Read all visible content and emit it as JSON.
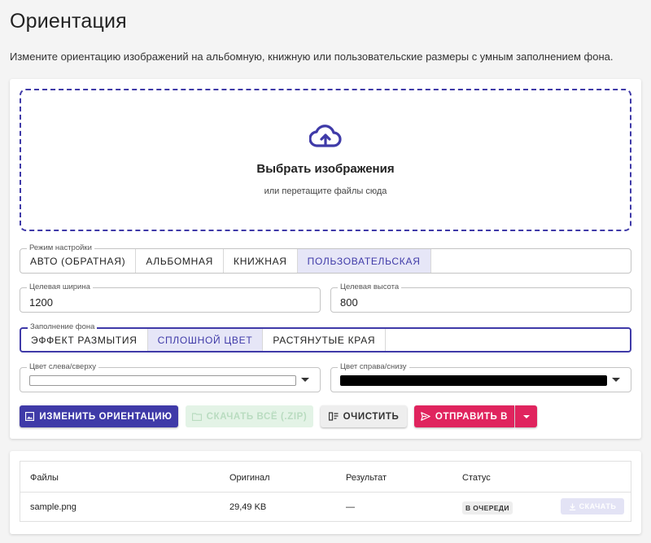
{
  "page": {
    "title": "Ориентация",
    "description": "Измените ориентацию изображений на альбомную, книжную или пользовательские размеры с умным заполнением фона."
  },
  "dropzone": {
    "title": "Выбрать изображения",
    "subtitle": "или перетащите файлы сюда",
    "icon": "cloud-upload-icon"
  },
  "mode": {
    "legend": "Режим настройки",
    "options": [
      "АВТО (ОБРАТНАЯ)",
      "АЛЬБОМНАЯ",
      "КНИЖНАЯ",
      "ПОЛЬЗОВАТЕЛЬСКАЯ"
    ],
    "selected": "ПОЛЬЗОВАТЕЛЬСКАЯ"
  },
  "width_field": {
    "label": "Целевая ширина",
    "value": "1200"
  },
  "height_field": {
    "label": "Целевая высота",
    "value": "800"
  },
  "fill": {
    "legend": "Заполнение фона",
    "options": [
      "ЭФФЕКТ РАЗМЫТИЯ",
      "СПЛОШНОЙ ЦВЕТ",
      "РАСТЯНУТЫЕ КРАЯ"
    ],
    "selected": "СПЛОШНОЙ ЦВЕТ"
  },
  "color_left": {
    "label": "Цвет слева/сверху",
    "value": "#ffffff"
  },
  "color_right": {
    "label": "Цвет справа/снизу",
    "value": "#000000"
  },
  "actions": {
    "rotate": "ИЗМЕНИТЬ ОРИЕНТАЦИЮ",
    "download_all": "СКАЧАТЬ ВСЁ (.ZIP)",
    "clear": "ОЧИСТИТЬ",
    "send_to": "ОТПРАВИТЬ В"
  },
  "colors": {
    "primary": "#3f3aa8",
    "accent": "#e0245e",
    "disabled_green": "#e3f3e6"
  },
  "table": {
    "headers": [
      "Файлы",
      "Оригинал",
      "Результат",
      "Статус"
    ],
    "rows": [
      {
        "file": "sample.png",
        "original": "29,49 KB",
        "result": "—",
        "status": "В ОЧЕРЕДИ",
        "action": "СКАЧАТЬ"
      }
    ]
  }
}
